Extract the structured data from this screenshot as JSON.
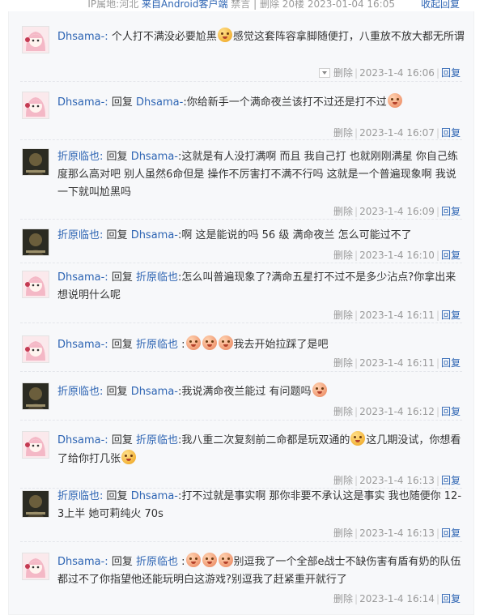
{
  "header": {
    "meta_prefix": "IP属地:河北",
    "meta_source": "来自Android客户端",
    "meta_suffix": "禁言 | 删除 20楼 2023-01-04 16:05",
    "collapse_label": "收起回复"
  },
  "common": {
    "delete_label": "删除",
    "reply_label": "回复",
    "reply_word": "回复"
  },
  "replies": [
    {
      "user": "Dhsama-:",
      "target": "",
      "avatar": "pink",
      "parts": [
        "个人打不满没必要尬黑",
        "感觉这套阵容拿脚随便打，八重放不放大都无所谓"
      ],
      "time": "2023-1-4 16:06",
      "has_dropdown": true
    },
    {
      "user": "Dhsama-:",
      "target": "Dhsama-",
      "avatar": "pink",
      "parts": [
        ":你给新手一个满命夜兰该打不过还是打不过",
        ""
      ],
      "time": "2023-1-4 16:07"
    },
    {
      "user": "折原临也:",
      "target": "Dhsama-",
      "avatar": "dark",
      "parts": [
        ":这就是有人没打满啊 而且 我自己打 也就刚刚满星 你自己练度那么高对吧 别人虽然6命但是 操作不厉害打不满不行吗 这就是一个普遍现象啊 我说一下就叫尬黑吗"
      ],
      "time": "2023-1-4 16:09"
    },
    {
      "user": "折原临也:",
      "target": "Dhsama-",
      "avatar": "dark",
      "parts": [
        ":啊 这是能说的吗 56 级 满命夜兰 怎么可能过不了"
      ],
      "time": "2023-1-4 16:10"
    },
    {
      "user": "Dhsama-:",
      "target": "折原临也",
      "avatar": "pink",
      "parts": [
        ":怎么叫普遍现象了?满命五星打不过不是多少沾点?你拿出来想说明什么呢"
      ],
      "time": "2023-1-4 16:11"
    },
    {
      "user": "Dhsama-:",
      "target": "折原临也",
      "avatar": "pink",
      "parts": [
        ":",
        "我去开始拉踩了是吧"
      ],
      "time": "2023-1-4 16:11"
    },
    {
      "user": "折原临也:",
      "target": "Dhsama-",
      "avatar": "dark",
      "parts": [
        ":我说满命夜兰能过 有问题吗",
        ""
      ],
      "time": "2023-1-4 16:12"
    },
    {
      "user": "Dhsama-:",
      "target": "折原临也",
      "avatar": "pink",
      "parts": [
        ":我八重二次复刻前二命都是玩双通的",
        "这几期没试，你想看了给你打几张",
        ""
      ],
      "time": "2023-1-4 16:13"
    },
    {
      "user": "折原临也:",
      "target": "Dhsama-",
      "avatar": "dark",
      "parts": [
        ":打不过就是事实啊 那你非要不承认这是事实 我也随便你 12-3上半 她可莉纯火 70s"
      ],
      "time": "2023-1-4 16:13"
    },
    {
      "user": "Dhsama-:",
      "target": "折原临也",
      "avatar": "pink",
      "parts": [
        ":",
        "别逗我了一个全部e战士不缺伤害有盾有奶的队伍都过不了你指望他还能玩明白这游戏?别逗我了赶紧重开就行了"
      ],
      "time": "2023-1-4 16:14"
    }
  ]
}
